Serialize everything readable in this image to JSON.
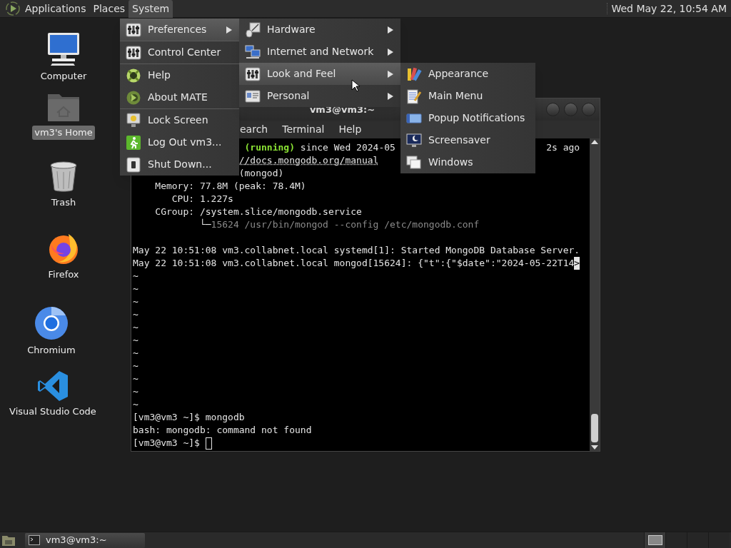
{
  "top_panel": {
    "menus": [
      {
        "label": "Applications",
        "selected": false
      },
      {
        "label": "Places",
        "selected": false
      },
      {
        "label": "System",
        "selected": true
      }
    ],
    "clock": "Wed May 22, 10:54 AM"
  },
  "desktop_icons": [
    {
      "label": "Computer",
      "kind": "computer",
      "selected": false
    },
    {
      "label": "vm3's Home",
      "kind": "home",
      "selected": true
    },
    {
      "label": "Trash",
      "kind": "trash",
      "selected": false
    },
    {
      "label": "Firefox",
      "kind": "firefox",
      "selected": false
    },
    {
      "label": "Chromium",
      "kind": "chromium",
      "selected": false
    },
    {
      "label": "Visual Studio Code",
      "kind": "vscode",
      "selected": false
    }
  ],
  "terminal": {
    "title": "vm3@vm3:~",
    "menus": [
      "earch",
      "Terminal",
      "Help"
    ],
    "lines": [
      {
        "parts": [
          {
            "text": "(running)",
            "kind": "green"
          },
          {
            "text": " since Wed 2024-05",
            "kind": "normal"
          },
          {
            "text": "2s ago",
            "kind": "normal"
          }
        ]
      },
      {
        "parts": [
          {
            "text": "//docs.mongodb.org/manual",
            "kind": "link"
          }
        ]
      },
      {
        "parts": [
          {
            "text": "(mongod)",
            "kind": "normal"
          }
        ]
      },
      {
        "parts": [
          {
            "text": "    Memory: 77.8M (peak: 78.4M)",
            "kind": "normal"
          }
        ]
      },
      {
        "parts": [
          {
            "text": "       CPU: 1.227s",
            "kind": "normal"
          }
        ]
      },
      {
        "parts": [
          {
            "text": "    CGroup: /system.slice/mongodb.service",
            "kind": "normal"
          }
        ]
      },
      {
        "parts": [
          {
            "text": "            └─",
            "kind": "normal"
          },
          {
            "text": "15624 /usr/bin/mongod --config /etc/mongodb.conf",
            "kind": "dim"
          }
        ]
      },
      {
        "parts": [
          {
            "text": "May 22 10:51:08 vm3.collabnet.local systemd[1]: Started MongoDB Database Server.",
            "kind": "normal"
          }
        ]
      },
      {
        "parts": [
          {
            "text": "May 22 10:51:08 vm3.collabnet.local mongod[15624]: {\"t\":{\"$date\":\"2024-05-22T14",
            "kind": "normal"
          },
          {
            "text": ">",
            "kind": "inverse"
          }
        ]
      },
      {
        "parts": [
          {
            "text": "~",
            "kind": "normal"
          }
        ]
      },
      {
        "parts": [
          {
            "text": "~",
            "kind": "normal"
          }
        ]
      },
      {
        "parts": [
          {
            "text": "~",
            "kind": "normal"
          }
        ]
      },
      {
        "parts": [
          {
            "text": "~",
            "kind": "normal"
          }
        ]
      },
      {
        "parts": [
          {
            "text": "~",
            "kind": "normal"
          }
        ]
      },
      {
        "parts": [
          {
            "text": "~",
            "kind": "normal"
          }
        ]
      },
      {
        "parts": [
          {
            "text": "~",
            "kind": "normal"
          }
        ]
      },
      {
        "parts": [
          {
            "text": "~",
            "kind": "normal"
          }
        ]
      },
      {
        "parts": [
          {
            "text": "~",
            "kind": "normal"
          }
        ]
      },
      {
        "parts": [
          {
            "text": "~",
            "kind": "normal"
          }
        ]
      },
      {
        "parts": [
          {
            "text": "~",
            "kind": "normal"
          }
        ]
      },
      {
        "parts": [
          {
            "text": "[vm3@vm3 ~]$ mongodb",
            "kind": "normal"
          }
        ]
      },
      {
        "parts": [
          {
            "text": "bash: mongodb: command not found",
            "kind": "normal"
          }
        ]
      },
      {
        "parts": [
          {
            "text": "[vm3@vm3 ~]$ ",
            "kind": "normal"
          }
        ],
        "cursor": true
      }
    ]
  },
  "system_menu": {
    "groups": [
      [
        {
          "label": "Preferences",
          "submenu": true,
          "selected": true
        }
      ],
      [
        {
          "label": "Control Center",
          "submenu": false,
          "selected": false
        }
      ],
      [
        {
          "label": "Help",
          "submenu": false,
          "selected": false
        },
        {
          "label": "About MATE",
          "submenu": false,
          "selected": false
        }
      ],
      [
        {
          "label": "Lock Screen",
          "submenu": false,
          "selected": false
        },
        {
          "label": "Log Out vm3...",
          "submenu": false,
          "selected": false
        },
        {
          "label": "Shut Down...",
          "submenu": false,
          "selected": false
        }
      ]
    ]
  },
  "preferences_menu": {
    "items": [
      {
        "label": "Hardware",
        "submenu": true,
        "selected": false
      },
      {
        "label": "Internet and Network",
        "submenu": true,
        "selected": false
      },
      {
        "label": "Look and Feel",
        "submenu": true,
        "selected": true
      },
      {
        "label": "Personal",
        "submenu": true,
        "selected": false
      }
    ]
  },
  "look_and_feel_menu": {
    "items": [
      {
        "label": "Appearance",
        "submenu": false,
        "selected": false
      },
      {
        "label": "Main Menu",
        "submenu": false,
        "selected": false
      },
      {
        "label": "Popup Notifications",
        "submenu": false,
        "selected": false
      },
      {
        "label": "Screensaver",
        "submenu": false,
        "selected": false
      },
      {
        "label": "Windows",
        "submenu": false,
        "selected": false
      }
    ]
  },
  "taskbar": {
    "tasks": [
      {
        "label": "vm3@vm3:~",
        "selected": true
      }
    ]
  }
}
